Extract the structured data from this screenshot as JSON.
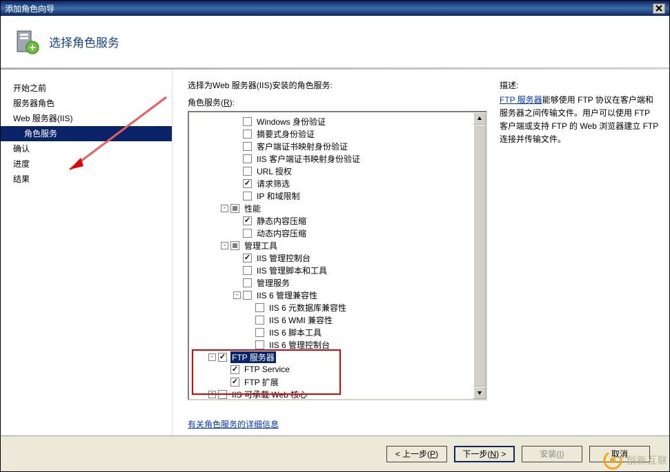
{
  "window": {
    "title": "添加角色向导"
  },
  "header": {
    "title": "选择角色服务"
  },
  "sidebar": {
    "items": [
      {
        "label": "开始之前",
        "indent": false
      },
      {
        "label": "服务器角色",
        "indent": false
      },
      {
        "label": "Web 服务器(IIS)",
        "indent": false
      },
      {
        "label": "角色服务",
        "indent": true,
        "active": true
      },
      {
        "label": "确认",
        "indent": false
      },
      {
        "label": "进度",
        "indent": false
      },
      {
        "label": "结果",
        "indent": false
      }
    ]
  },
  "main": {
    "intro": "选择为Web 服务器(IIS)安装的角色服务:",
    "listLabelPrefix": "角色服务(",
    "listAccel": "R",
    "listLabelSuffix": "):",
    "detailLink": "有关角色服务的详细信息",
    "tree": [
      {
        "indent": 3,
        "exp": "",
        "chk": "unchecked",
        "label": "Windows 身份验证"
      },
      {
        "indent": 3,
        "exp": "",
        "chk": "unchecked",
        "label": "摘要式身份验证"
      },
      {
        "indent": 3,
        "exp": "",
        "chk": "unchecked",
        "label": "客户端证书映射身份验证"
      },
      {
        "indent": 3,
        "exp": "",
        "chk": "unchecked",
        "label": "IIS 客户端证书映射身份验证"
      },
      {
        "indent": 3,
        "exp": "",
        "chk": "unchecked",
        "label": "URL 授权"
      },
      {
        "indent": 3,
        "exp": "",
        "chk": "checked",
        "label": "请求筛选"
      },
      {
        "indent": 3,
        "exp": "",
        "chk": "unchecked",
        "label": "IP 和域限制"
      },
      {
        "indent": 2,
        "exp": "-",
        "chk": "mixed",
        "label": "性能"
      },
      {
        "indent": 3,
        "exp": "",
        "chk": "checked",
        "label": "静态内容压缩"
      },
      {
        "indent": 3,
        "exp": "",
        "chk": "unchecked",
        "label": "动态内容压缩"
      },
      {
        "indent": 2,
        "exp": "-",
        "chk": "mixed",
        "label": "管理工具"
      },
      {
        "indent": 3,
        "exp": "",
        "chk": "checked",
        "label": "IIS 管理控制台"
      },
      {
        "indent": 3,
        "exp": "",
        "chk": "unchecked",
        "label": "IIS 管理脚本和工具"
      },
      {
        "indent": 3,
        "exp": "",
        "chk": "unchecked",
        "label": "管理服务"
      },
      {
        "indent": 3,
        "exp": "-",
        "chk": "unchecked",
        "label": "IIS 6 管理兼容性"
      },
      {
        "indent": 4,
        "exp": "",
        "chk": "unchecked",
        "label": "IIS 6 元数据库兼容性"
      },
      {
        "indent": 4,
        "exp": "",
        "chk": "unchecked",
        "label": "IIS 6 WMI 兼容性"
      },
      {
        "indent": 4,
        "exp": "",
        "chk": "unchecked",
        "label": "IIS 6 脚本工具"
      },
      {
        "indent": 4,
        "exp": "",
        "chk": "unchecked",
        "label": "IIS 6 管理控制台"
      },
      {
        "indent": 1,
        "exp": "-",
        "chk": "checked",
        "label": "FTP 服务器",
        "selected": true
      },
      {
        "indent": 2,
        "exp": "",
        "chk": "checked",
        "label": "FTP Service"
      },
      {
        "indent": 2,
        "exp": "",
        "chk": "checked",
        "label": "FTP 扩展"
      },
      {
        "indent": 1,
        "exp": "+",
        "chk": "unchecked",
        "label": "IIS 可承载 Web 核心"
      }
    ]
  },
  "right": {
    "descTitle": "描述:",
    "linkLabel": "FTP 服务器",
    "descBody": "能够使用 FTP 协议在客户端和服务器之间传输文件。用户可以使用 FTP 客户端或支持 FTP 的 Web 浏览器建立 FTP 连接并传输文件。"
  },
  "footer": {
    "prev": {
      "pre": "< 上一步(",
      "accel": "P",
      "post": ")"
    },
    "next": {
      "pre": "下一步(",
      "accel": "N",
      "post": ") >"
    },
    "install": {
      "pre": "安装(",
      "accel": "I",
      "post": ")"
    },
    "cancel": "取消"
  },
  "watermark": "创新互联"
}
